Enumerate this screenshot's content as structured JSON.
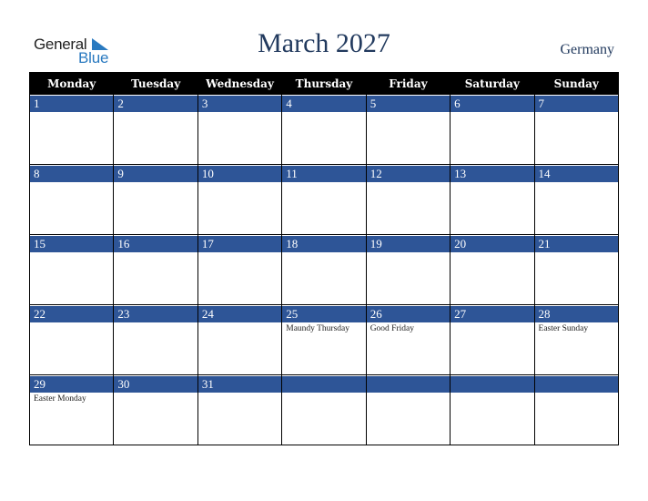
{
  "logo": {
    "general": "General",
    "blue": "Blue",
    "icon": "triangle-flag-icon"
  },
  "header": {
    "title": "March 2027",
    "country": "Germany"
  },
  "colors": {
    "header_bg": "#000000",
    "date_band": "#2e5597",
    "title": "#223a5e",
    "logo_blue": "#2a7ac0"
  },
  "weekdays": [
    "Monday",
    "Tuesday",
    "Wednesday",
    "Thursday",
    "Friday",
    "Saturday",
    "Sunday"
  ],
  "weeks": [
    [
      {
        "day": "1",
        "holiday": ""
      },
      {
        "day": "2",
        "holiday": ""
      },
      {
        "day": "3",
        "holiday": ""
      },
      {
        "day": "4",
        "holiday": ""
      },
      {
        "day": "5",
        "holiday": ""
      },
      {
        "day": "6",
        "holiday": ""
      },
      {
        "day": "7",
        "holiday": ""
      }
    ],
    [
      {
        "day": "8",
        "holiday": ""
      },
      {
        "day": "9",
        "holiday": ""
      },
      {
        "day": "10",
        "holiday": ""
      },
      {
        "day": "11",
        "holiday": ""
      },
      {
        "day": "12",
        "holiday": ""
      },
      {
        "day": "13",
        "holiday": ""
      },
      {
        "day": "14",
        "holiday": ""
      }
    ],
    [
      {
        "day": "15",
        "holiday": ""
      },
      {
        "day": "16",
        "holiday": ""
      },
      {
        "day": "17",
        "holiday": ""
      },
      {
        "day": "18",
        "holiday": ""
      },
      {
        "day": "19",
        "holiday": ""
      },
      {
        "day": "20",
        "holiday": ""
      },
      {
        "day": "21",
        "holiday": ""
      }
    ],
    [
      {
        "day": "22",
        "holiday": ""
      },
      {
        "day": "23",
        "holiday": ""
      },
      {
        "day": "24",
        "holiday": ""
      },
      {
        "day": "25",
        "holiday": "Maundy Thursday"
      },
      {
        "day": "26",
        "holiday": "Good Friday"
      },
      {
        "day": "27",
        "holiday": ""
      },
      {
        "day": "28",
        "holiday": "Easter Sunday"
      }
    ],
    [
      {
        "day": "29",
        "holiday": "Easter Monday"
      },
      {
        "day": "30",
        "holiday": ""
      },
      {
        "day": "31",
        "holiday": ""
      },
      {
        "day": "",
        "holiday": ""
      },
      {
        "day": "",
        "holiday": ""
      },
      {
        "day": "",
        "holiday": ""
      },
      {
        "day": "",
        "holiday": ""
      }
    ]
  ]
}
